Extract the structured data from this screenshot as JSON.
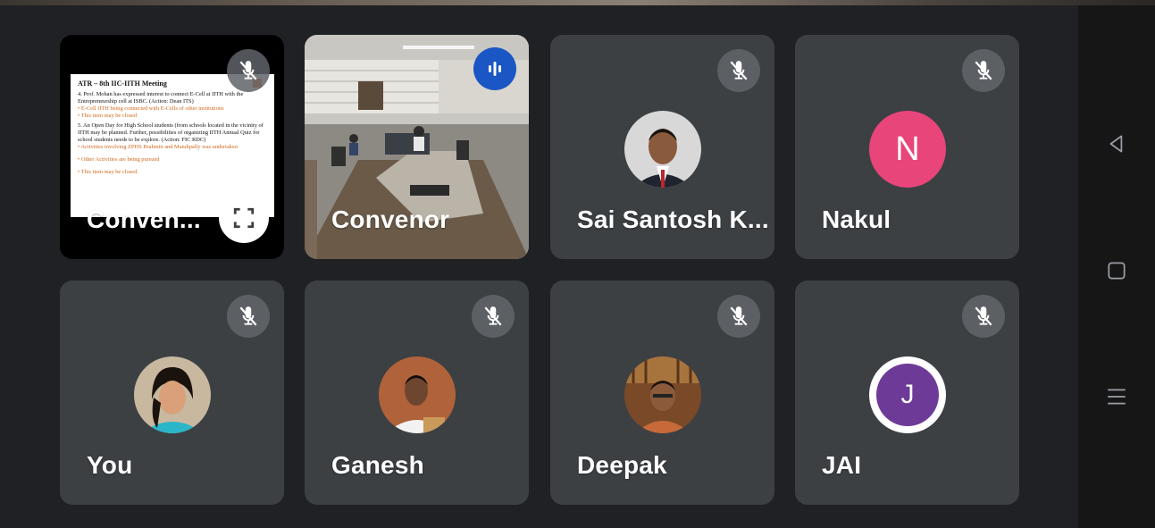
{
  "colors": {
    "background": "#202124",
    "tile": "#3c4043",
    "nakul_avatar": "#e8457a",
    "jai_avatar": "#6e3a98",
    "speaking_indicator": "#1a56c4"
  },
  "presentation": {
    "slide_title": "ATR – 8th IIC-IITH Meeting",
    "slide_items": [
      "4. Prof. Mohan has expressed interest to connect E-Cell at IITH with the Entrepreneurship cell at ISBC. (Action: Dean ITS)",
      "• E-Cell IITH being connected with E-Cells of other institutions",
      "• This item may be closed",
      "5. An Open Day for High School students (from schools located in the vicinity of IITH may be planned. Further, possibilities of organizing IITH Annual Quiz for school students needs to be explore. (Action: FIC RDC)",
      "• Activities involving ZPHS Brahmin and Mandipally was undertaken",
      "• Other Activities are being pursued",
      "• This item may be closed."
    ]
  },
  "participants": [
    {
      "name": "Conven...",
      "muted": true,
      "kind": "presentation"
    },
    {
      "name": "Convenor",
      "muted": false,
      "kind": "video",
      "speaking": true
    },
    {
      "name": "Sai Santosh K...",
      "muted": true,
      "kind": "photo"
    },
    {
      "name": "Nakul",
      "muted": true,
      "kind": "letter",
      "initial": "N"
    },
    {
      "name": "You",
      "muted": true,
      "kind": "photo"
    },
    {
      "name": "Ganesh",
      "muted": true,
      "kind": "photo"
    },
    {
      "name": "Deepak",
      "muted": true,
      "kind": "photo"
    },
    {
      "name": "JAI",
      "muted": true,
      "kind": "letter",
      "initial": "J"
    }
  ],
  "icons": {
    "mic": "mic-off-icon",
    "speaking": "audio-level-icon",
    "fullscreen": "fullscreen-icon",
    "nav_back": "back-triangle-icon",
    "nav_home": "home-square-icon",
    "nav_recents": "recents-menu-icon"
  }
}
